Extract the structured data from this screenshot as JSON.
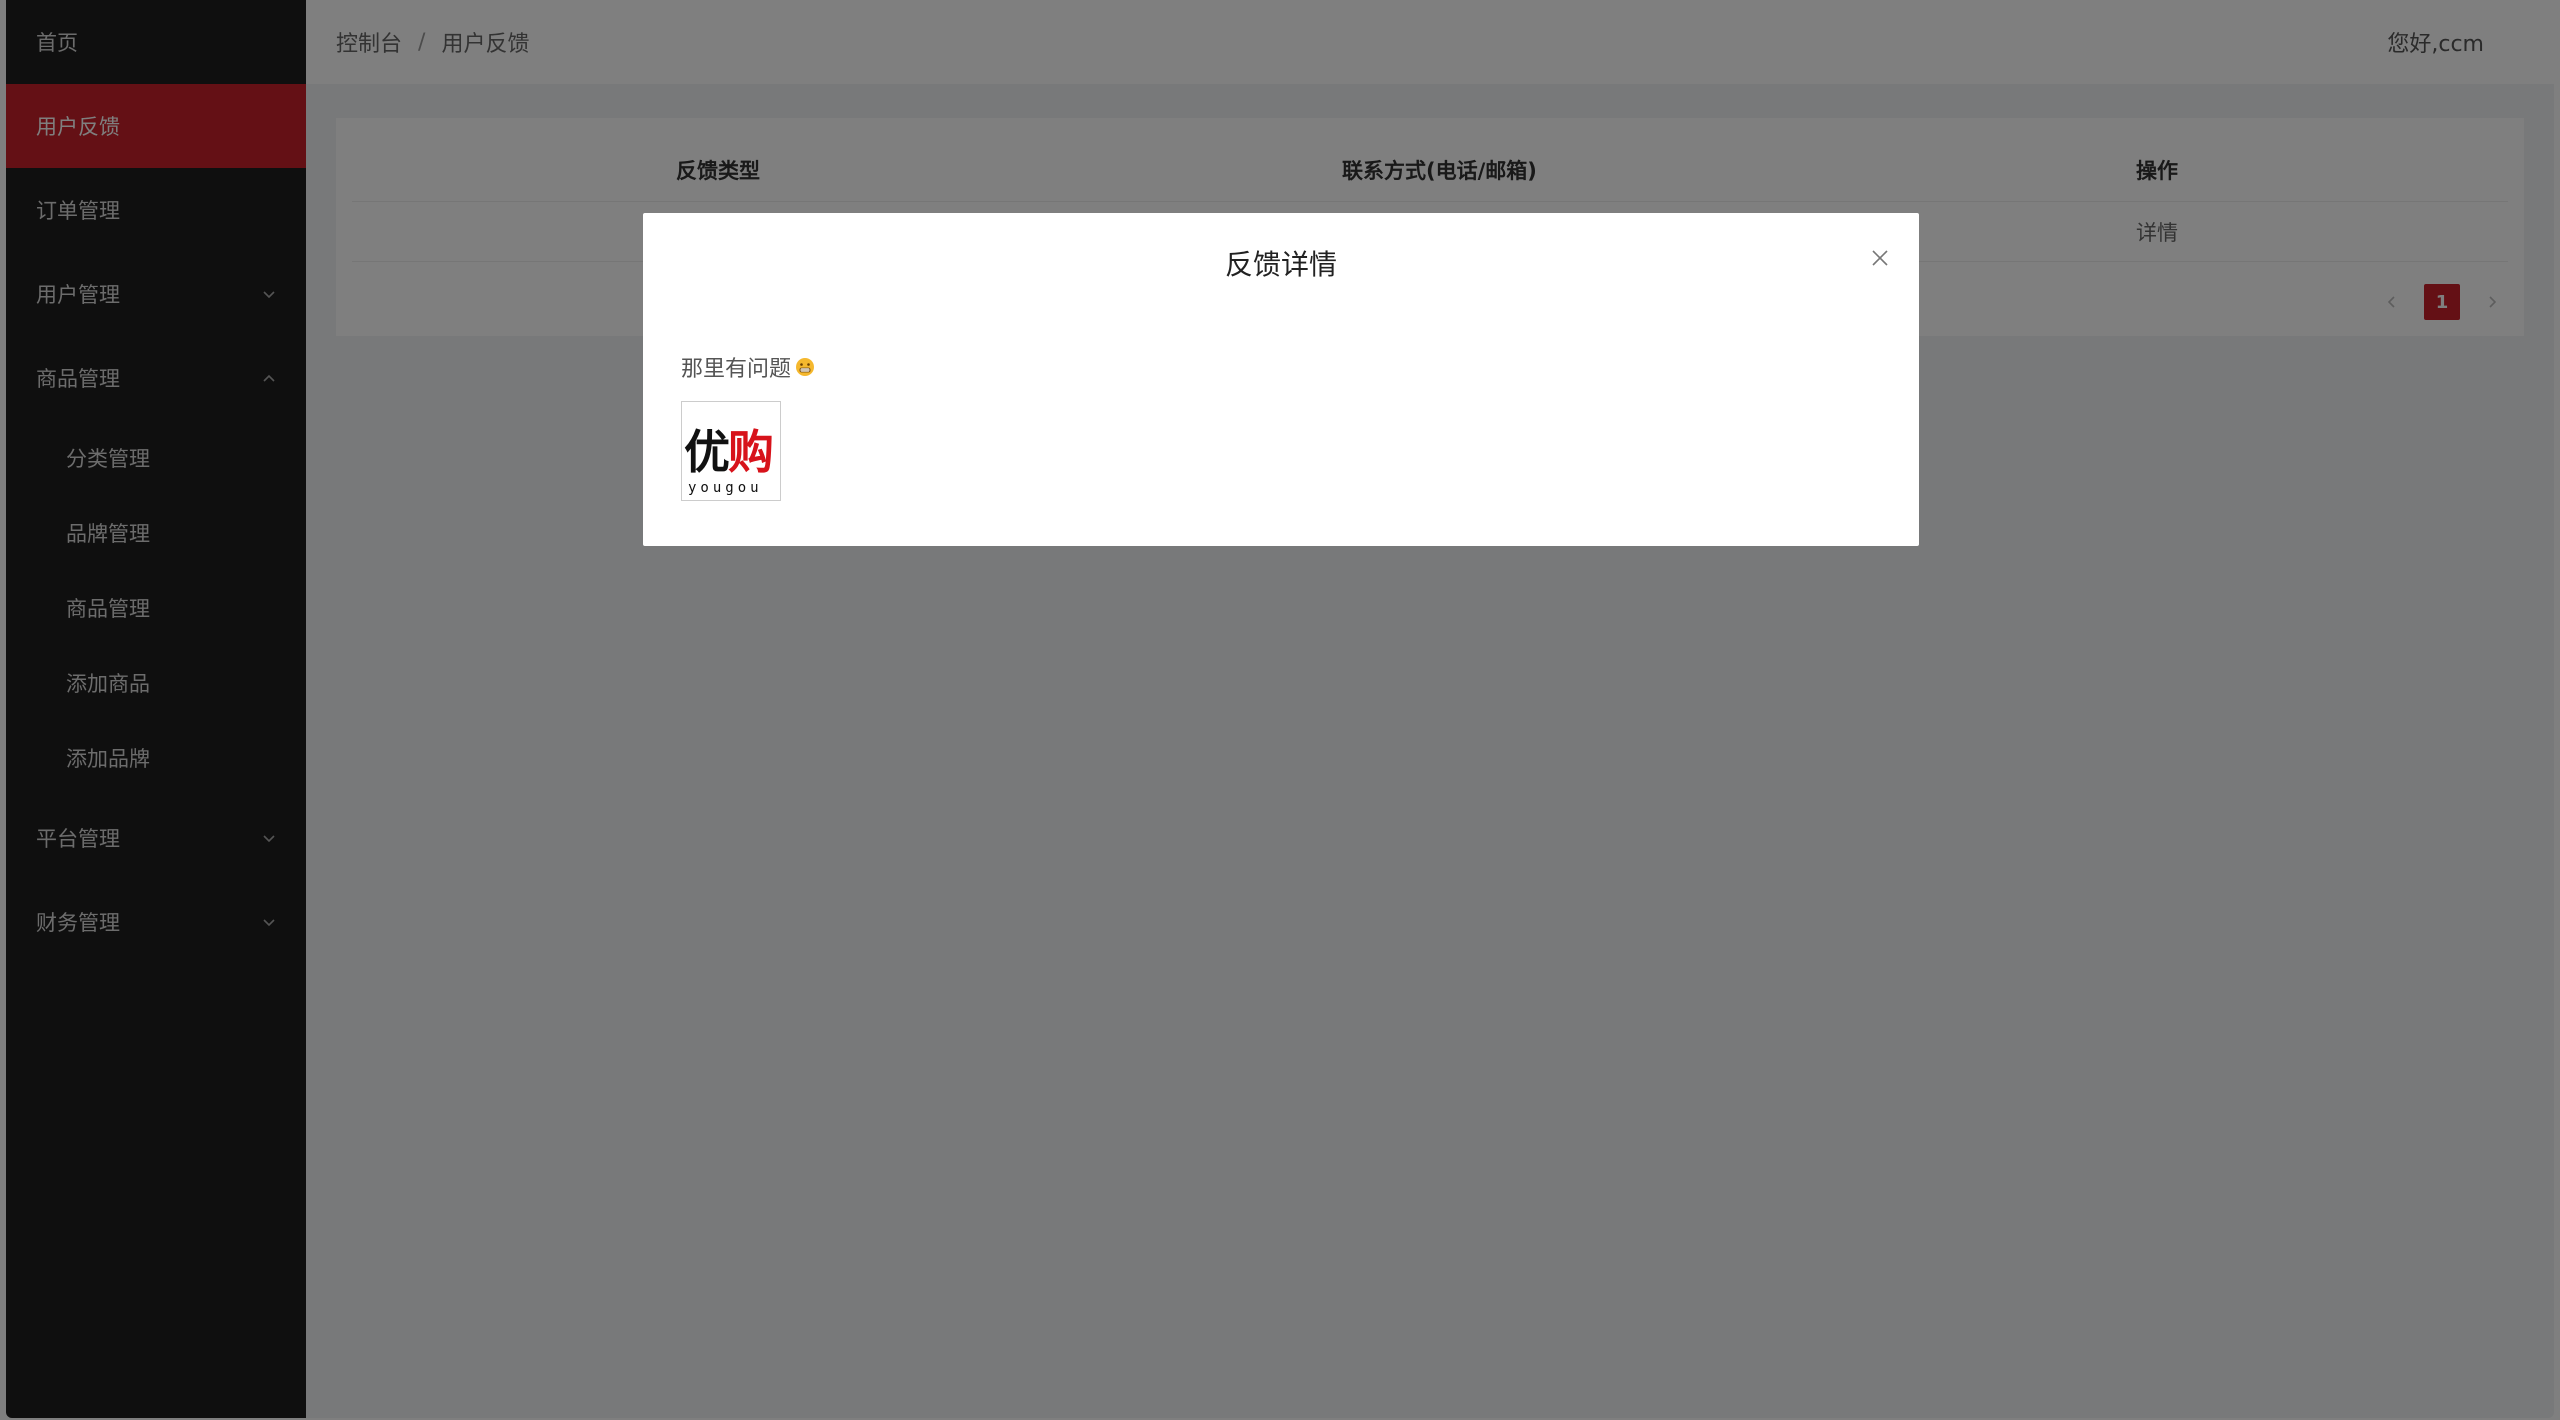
{
  "sidebar": {
    "items": [
      {
        "label": "首页"
      },
      {
        "label": "用户反馈"
      },
      {
        "label": "订单管理"
      },
      {
        "label": "用户管理"
      },
      {
        "label": "商品管理"
      },
      {
        "label": "平台管理"
      },
      {
        "label": "财务管理"
      }
    ],
    "sub_items": [
      {
        "label": "分类管理"
      },
      {
        "label": "品牌管理"
      },
      {
        "label": "商品管理"
      },
      {
        "label": "添加商品"
      },
      {
        "label": "添加品牌"
      }
    ]
  },
  "header": {
    "breadcrumb": [
      "控制台",
      "用户反馈"
    ],
    "separator": "/",
    "greeting": "您好,ccm"
  },
  "table": {
    "columns": [
      "反馈类型",
      "联系方式(电话/邮箱)",
      "操作"
    ],
    "rows": [
      {
        "action": "详情"
      }
    ]
  },
  "pagination": {
    "current_page": "1"
  },
  "modal": {
    "title": "反馈详情",
    "text": "那里有问题",
    "image_logo_text": "优购",
    "image_logo_sub": "yougou"
  },
  "colors": {
    "accent": "#c8202a",
    "sidebar_bg": "#1f1f1f"
  },
  "icons": {
    "close": "close-icon",
    "prev": "chevron-left-icon",
    "next": "chevron-right-icon",
    "expand": "chevron-down-icon",
    "collapse": "chevron-up-icon",
    "emoji": "grin-emoji-icon"
  }
}
